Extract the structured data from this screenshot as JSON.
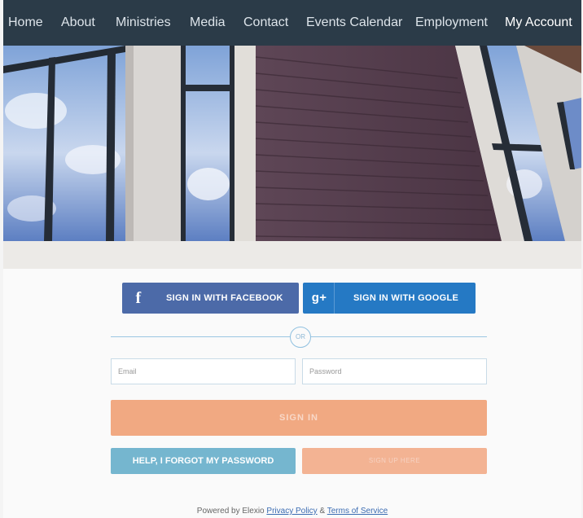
{
  "nav": {
    "items": [
      "Home",
      "About",
      "Ministries",
      "Media",
      "Contact",
      "Events Calendar",
      "Employment",
      "My Account"
    ],
    "active": "My Account"
  },
  "login": {
    "facebook_label": "SIGN IN WITH FACEBOOK",
    "google_label": "SIGN IN WITH GOOGLE",
    "facebook_glyph": "f",
    "google_glyph": "g+",
    "or_label": "OR",
    "email_placeholder": "Email",
    "password_placeholder": "Password",
    "signin_label": "SIGN IN",
    "forgot_label": "HELP, I FORGOT MY PASSWORD",
    "signup_label": "SIGN UP HERE"
  },
  "footer": {
    "powered_by": "Powered by Elexio",
    "privacy": "Privacy Policy",
    "amp": "&",
    "terms": "Terms of Service"
  },
  "colors": {
    "nav_bg": "#2b3b48",
    "facebook": "#4c6aa8",
    "google": "#2579c4",
    "signin": "#f1a982",
    "forgot": "#75b6cf",
    "link": "#3b6cb2"
  }
}
